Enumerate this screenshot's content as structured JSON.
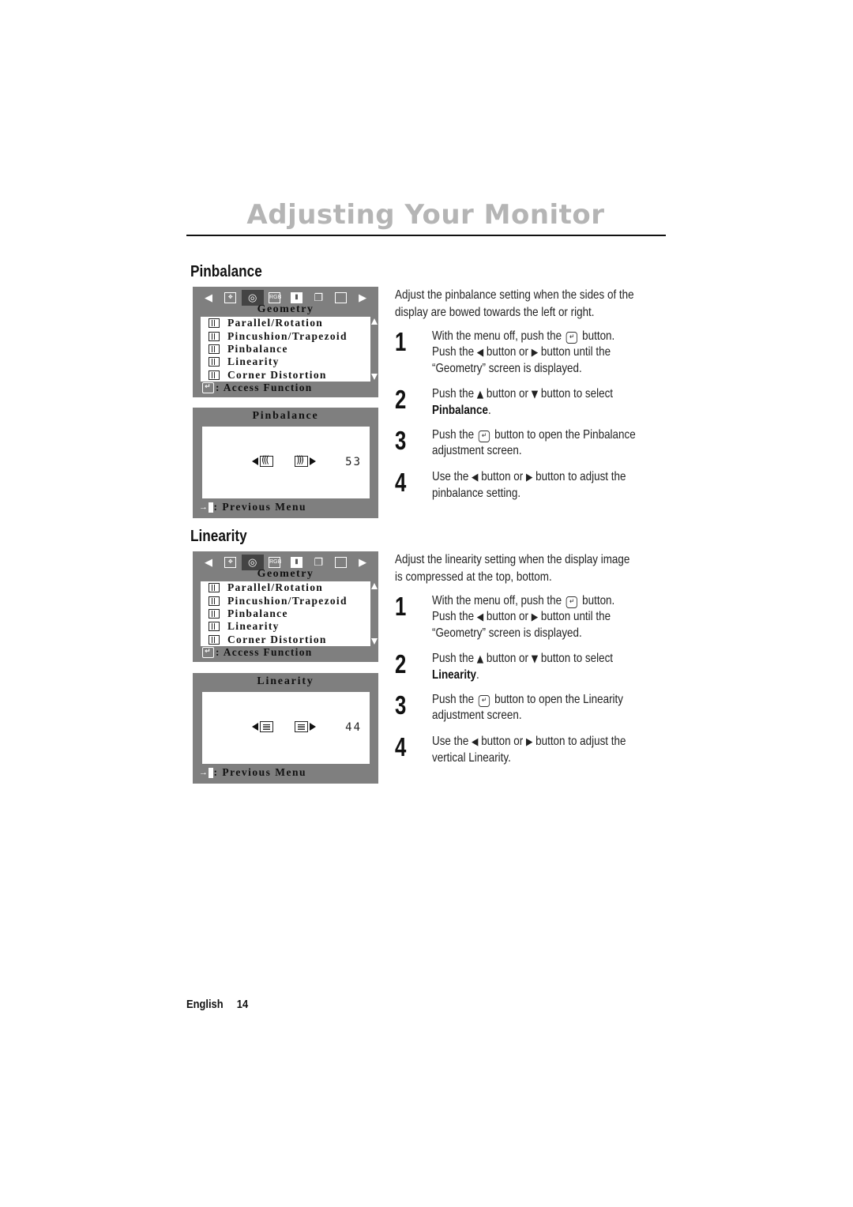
{
  "page": {
    "title": "Adjusting Your Monitor",
    "footer": {
      "language": "English",
      "page_number": "14"
    }
  },
  "osd_common": {
    "icons": [
      "left-arrow",
      "position",
      "geometry",
      "rgb-color",
      "sharpness",
      "multi-window",
      "layout",
      "right-arrow"
    ],
    "rgb_label": "RGB",
    "category": "Geometry",
    "items": [
      "Parallel/Rotation",
      "Pincushion/Trapezoid",
      "Pinbalance",
      "Linearity",
      "Corner Distortion"
    ],
    "access_label": ": Access Function",
    "previous_label": ": Previous Menu"
  },
  "sections": [
    {
      "heading": "Pinbalance",
      "adjust_title": "Pinbalance",
      "value": "53",
      "intro_line1": "Adjust the pinbalance setting when the sides of the",
      "intro_line2": "display are bowed towards the left or right.",
      "steps": [
        {
          "num": "1",
          "a": "With the menu off, push the",
          "b": "button.",
          "c": "Push the",
          "d": "button or",
          "e": "button until the",
          "f": "“Geometry” screen is displayed."
        },
        {
          "num": "2",
          "a": "Push the",
          "b": "button or",
          "c": "button to select",
          "bold": "Pinbalance",
          "end": "."
        },
        {
          "num": "3",
          "a": "Push the",
          "b": "button to open the Pinbalance",
          "c": "adjustment screen."
        },
        {
          "num": "4",
          "a": "Use the",
          "b": "button or",
          "c": "button to adjust the",
          "d": "pinbalance setting."
        }
      ]
    },
    {
      "heading": "Linearity",
      "adjust_title": "Linearity",
      "value": "44",
      "intro_line1": "Adjust the linearity setting when the display image",
      "intro_line2": "is compressed at the top, bottom.",
      "steps": [
        {
          "num": "1",
          "a": "With the menu off, push the",
          "b": "button.",
          "c": "Push the",
          "d": "button or",
          "e": "button until the",
          "f": "“Geometry” screen is displayed."
        },
        {
          "num": "2",
          "a": "Push the",
          "b": "button or",
          "c": "button to select",
          "bold": "Linearity",
          "end": "."
        },
        {
          "num": "3",
          "a": "Push the",
          "b": "button to open the Linearity",
          "c": "adjustment screen."
        },
        {
          "num": "4",
          "a": "Use the",
          "b": "button or",
          "c": "button to adjust the",
          "d": "vertical Linearity."
        }
      ]
    }
  ]
}
